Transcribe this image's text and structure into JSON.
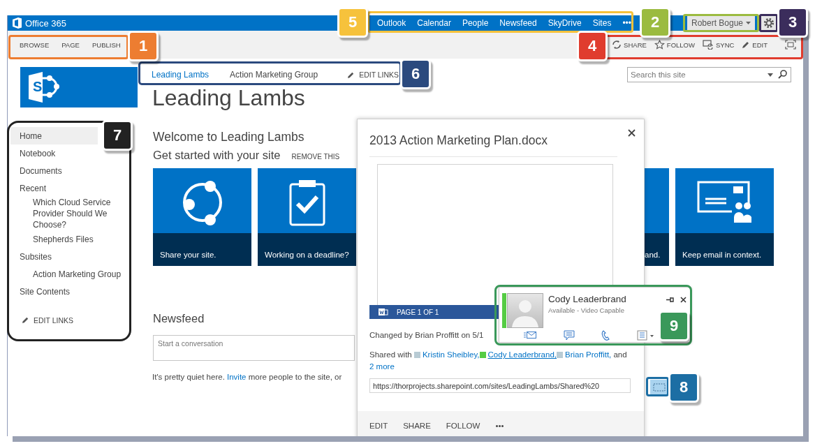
{
  "suite_bar": {
    "brand": "Office 365",
    "links": [
      {
        "label": "Outlook"
      },
      {
        "label": "Calendar"
      },
      {
        "label": "People"
      },
      {
        "label": "Newsfeed"
      },
      {
        "label": "SkyDrive"
      },
      {
        "label": "Sites"
      },
      {
        "label": "•••"
      }
    ],
    "user": "Robert Bogue"
  },
  "ribbon": {
    "tabs": [
      {
        "label": "BROWSE"
      },
      {
        "label": "PAGE"
      },
      {
        "label": "PUBLISH"
      }
    ],
    "actions": [
      {
        "kind": "share",
        "label": "SHARE"
      },
      {
        "kind": "follow",
        "label": "FOLLOW"
      },
      {
        "kind": "sync",
        "label": "SYNC"
      },
      {
        "kind": "edit",
        "label": "EDIT"
      },
      {
        "kind": "focus"
      }
    ]
  },
  "site": {
    "logo_letter": "S",
    "title": "Leading Lambs",
    "top_nav": [
      {
        "label": "Leading Lambs",
        "selected": true
      },
      {
        "label": "Action Marketing Group",
        "selected": false
      }
    ],
    "edit_links": "EDIT LINKS",
    "search": {
      "placeholder": "Search this site"
    }
  },
  "quick_launch": {
    "items": [
      {
        "label": "Home",
        "selected": true
      },
      {
        "label": "Notebook",
        "selected": false
      },
      {
        "label": "Documents",
        "selected": false
      },
      {
        "label": "Recent",
        "selected": false,
        "children": [
          {
            "label": "Which Cloud Service Provider Should We Choose?",
            "selected": false
          },
          {
            "label": "Shepherds Files",
            "selected": false
          }
        ]
      },
      {
        "label": "Subsites",
        "selected": false,
        "children": [
          {
            "label": "Action Marketing Group",
            "selected": false
          }
        ]
      },
      {
        "label": "Site Contents",
        "selected": false
      }
    ],
    "edit_links": "EDIT LINKS"
  },
  "welcome": {
    "heading": "Welcome to Leading Lambs",
    "subheading": "Get started with your site",
    "remove": "REMOVE THIS",
    "tiles": [
      {
        "kind": "share",
        "caption": "Share your site."
      },
      {
        "kind": "deadline",
        "caption": "Working on a deadline?"
      },
      {
        "kind": "partial",
        "caption": "and."
      },
      {
        "kind": "email",
        "caption": "Keep email in context."
      }
    ]
  },
  "newsfeed": {
    "heading": "Newsfeed",
    "placeholder": "Start a conversation",
    "note_before": "It's pretty quiet here.",
    "note_link": "Invite",
    "note_after": "more people to the site, or"
  },
  "document_callout": {
    "title": "2013 Action Marketing Plan.docx",
    "page_label": "PAGE 1 OF 1",
    "changed": "Changed by Brian Proffitt on 5/1",
    "shared_prefix": "Shared with",
    "shared_people": [
      {
        "name": "Kristin Sheibley,",
        "color": "#b8cbd4",
        "hovered": false
      },
      {
        "name": "Cody Leaderbrand,",
        "color": "#55cc44",
        "hovered": true
      },
      {
        "name": "Brian Proffitt,",
        "color": "#b8cbd4",
        "hovered": false
      }
    ],
    "more_prefix": "and",
    "more": "2 more",
    "url": "https://thorprojects.sharepoint.com/sites/LeadingLambs/Shared%20",
    "actions": [
      {
        "label": "EDIT"
      },
      {
        "label": "SHARE"
      },
      {
        "label": "FOLLOW"
      },
      {
        "label": "•••"
      }
    ]
  },
  "contact_card": {
    "name": "Cody Leaderbrand",
    "status": "Available - Video Capable",
    "online": true
  },
  "callouts": [
    {
      "number": "1",
      "color": "#ed7d31"
    },
    {
      "number": "2",
      "color": "#9bbb40"
    },
    {
      "number": "3",
      "color": "#3b2d5c"
    },
    {
      "number": "4",
      "color": "#e03c2e"
    },
    {
      "number": "5",
      "color": "#f6c23c"
    },
    {
      "number": "6",
      "color": "#2b4a7e"
    },
    {
      "number": "7",
      "color": "#222222"
    },
    {
      "number": "8",
      "color": "#1c6ea4"
    },
    {
      "number": "9",
      "color": "#3a985a"
    }
  ]
}
